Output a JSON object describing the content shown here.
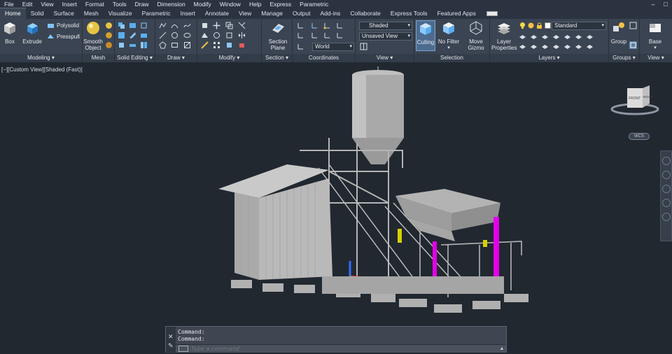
{
  "menubar": {
    "items": [
      "File",
      "Edit",
      "View",
      "Insert",
      "Format",
      "Tools",
      "Draw",
      "Dimension",
      "Modify",
      "Window",
      "Help",
      "Express",
      "Parametric"
    ],
    "window_controls": [
      "–",
      "□"
    ]
  },
  "tabs": {
    "items": [
      "Home",
      "Solid",
      "Surface",
      "Mesh",
      "Visualize",
      "Parametric",
      "Insert",
      "Annotate",
      "View",
      "Manage",
      "Output",
      "Add-ins",
      "Collaborate",
      "Express Tools",
      "Featured Apps"
    ],
    "active": "Home"
  },
  "ribbon": {
    "modeling": {
      "title": "Modeling",
      "box": "Box",
      "extrude": "Extrude",
      "polysolid": "Polysolid",
      "presspull": "Presspull"
    },
    "mesh": {
      "title": "Mesh",
      "smooth_object": "Smooth Object"
    },
    "solid_editing": {
      "title": "Solid Editing"
    },
    "draw": {
      "title": "Draw"
    },
    "modify": {
      "title": "Modify"
    },
    "section": {
      "title": "Section",
      "section_plane": "Section Plane"
    },
    "coordinates": {
      "title": "Coordinates",
      "ucs_value": "World"
    },
    "view": {
      "title": "View",
      "visual_style": "Shaded",
      "named_view": "Unsaved View"
    },
    "selection": {
      "title": "Selection",
      "culling": "Culling",
      "no_filter": "No Filter",
      "move_gizmo": "Move Gizmo"
    },
    "layers": {
      "title": "Layers",
      "layer_properties": "Layer Properties",
      "layer_value": "Standard"
    },
    "groups": {
      "title": "Groups",
      "group": "Group"
    },
    "view2": {
      "title": "View",
      "base": "Base"
    }
  },
  "viewport": {
    "label": "[−][Custom View][Shaded (Fast)]",
    "viewcube_front": "FRONT",
    "viewcube_right": "RIGHT",
    "wcs": "WCS"
  },
  "command": {
    "history": [
      "Command:",
      "Command:"
    ],
    "placeholder": "Type a command"
  },
  "colors": {
    "accent": "#e100e6",
    "highlight_yellow": "#d8d000",
    "ribbon_bg": "#3b4452",
    "canvas_bg": "#212830"
  }
}
